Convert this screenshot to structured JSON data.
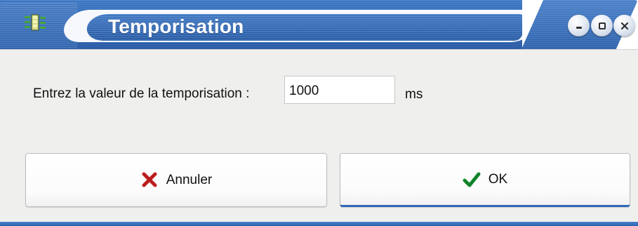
{
  "window": {
    "title": "Temporisation",
    "controls": {
      "minimize_icon": "minimize-icon",
      "maximize_icon": "maximize-icon",
      "close_icon": "close-icon"
    },
    "app_icon": "app-icon"
  },
  "form": {
    "prompt": "Entrez la valeur de la temporisation :",
    "delay_value": "1000",
    "unit": "ms"
  },
  "actions": {
    "cancel_label": "Annuler",
    "ok_label": "OK",
    "cancel_icon": "cancel-x-icon",
    "ok_icon": "checkmark-icon"
  },
  "colors": {
    "titlebar_blue": "#2f65b2",
    "cancel_red": "#c52222",
    "ok_green": "#148b2e",
    "client_gray": "#efefee"
  }
}
